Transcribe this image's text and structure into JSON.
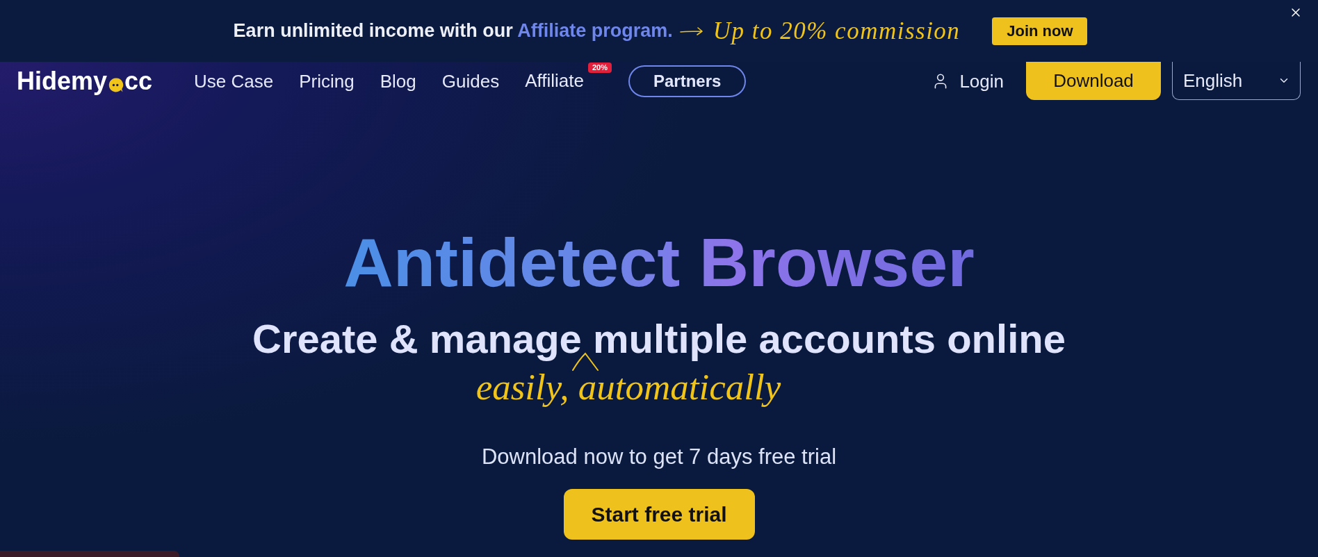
{
  "banner": {
    "text": "Earn unlimited income with our",
    "link": "Affiliate program.",
    "tagline": "Up to 20% commission",
    "button": "Join now"
  },
  "nav": {
    "logo": {
      "before": "Hidemy",
      "after": "cc"
    },
    "items": [
      {
        "label": "Use Case"
      },
      {
        "label": "Pricing"
      },
      {
        "label": "Blog"
      },
      {
        "label": "Guides"
      },
      {
        "label": "Affiliate",
        "badge": "20%"
      }
    ],
    "partners": "Partners",
    "login": "Login",
    "download": "Download",
    "language": "English"
  },
  "hero": {
    "title": "Antidetect Browser",
    "subtitle": "Create & manage multiple accounts online",
    "handwritten": "easily, automatically",
    "note": "Download now to get 7 days free trial",
    "cta": "Start free trial"
  }
}
